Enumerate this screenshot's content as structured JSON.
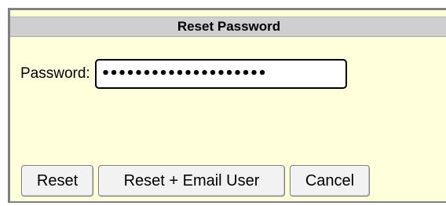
{
  "dialog": {
    "title": "Reset Password",
    "password_label": "Password:",
    "password_masked": "••••••••••••••••••••",
    "buttons": {
      "reset": "Reset",
      "reset_email": "Reset + Email User",
      "cancel": "Cancel"
    }
  },
  "colors": {
    "background": "#ffffdc",
    "title_bar": "#cfcfcf",
    "border": "#808080"
  }
}
